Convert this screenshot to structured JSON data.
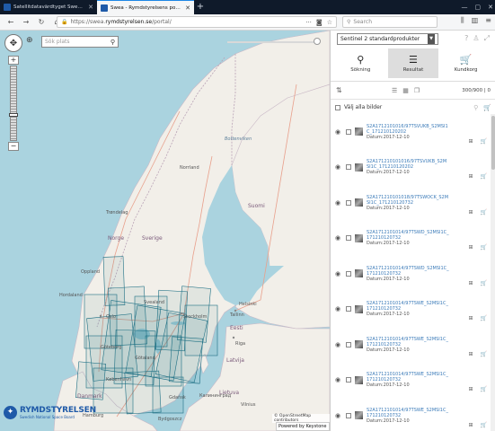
{
  "browser": {
    "tabs": [
      {
        "title": "Satellitdatavärdtyget Swea - Ry",
        "active": false,
        "favicon_color": "#1f5aa8"
      },
      {
        "title": "Swea - Rymdstyrelsens portal f",
        "active": true,
        "favicon_color": "#1f5aa8"
      }
    ],
    "new_tab": "+",
    "url_prefix": "https://swea.",
    "url_domain": "rymdstyrelsen.se",
    "url_path": "/portal/",
    "search_placeholder": "Search"
  },
  "map": {
    "search_placeholder": "Sök plats",
    "zoom_in": "+",
    "zoom_out": "−",
    "labels": {
      "norway": "Norge",
      "sweden": "Sverige",
      "finland": "Suomi",
      "estonia": "Eesti",
      "latvia": "Latvija",
      "lithuania": "Lietuva",
      "denmark": "Danmark",
      "norrland": "Norrland",
      "svealand": "Svealand",
      "gotaland": "Götaland",
      "oppland": "Oppland",
      "hordaland": "Hordaland",
      "trondelag": "Trøndelag",
      "oslo": "Oslo",
      "stockholm": "Stockholm",
      "helsinki": "Helsinki",
      "tallinn": "Tallinn",
      "riga": "Riga",
      "vilnius": "Vilnius",
      "kaliningrad": "Калининград",
      "gdansk": "Gdańsk",
      "bydgoszcz": "Bydgoszcz",
      "hamburg": "Hamburg",
      "kobenhavn": "København",
      "goteborg": "Göteborg",
      "bothnia": "Bottenviken"
    },
    "logo_name": "RYMDSTYRELSEN",
    "logo_sub": "Swedish National Space Board",
    "attribution": "© OpenStreetMap contributors",
    "powered_by": "Powered by Keystone"
  },
  "panel": {
    "product": "Sentinel 2 standardprodukter",
    "tabs": [
      {
        "label": "Sökning",
        "icon": "search-icon",
        "active": false
      },
      {
        "label": "Resultat",
        "icon": "list-icon",
        "active": true
      },
      {
        "label": "Kundkorg",
        "icon": "cart-icon",
        "active": false
      }
    ],
    "count": "300/900 | 0",
    "select_all": "Välj alla bilder",
    "results": [
      {
        "name": "S2A1712101016/97TSVUKB_S2MSI1C_171210120202",
        "date": "Datum:2017-12-10"
      },
      {
        "name": "S2A171210101016/97TSVUKB_S2MSI1C_171210120202",
        "date": "Datum:2017-12-10"
      },
      {
        "name": "S2A171210101018/97TSWOCK_S2MSI1C_171210120732",
        "date": "Datum:2017-12-10"
      },
      {
        "name": "S2A1712101014/97TSWD_S2MSI1C_171210120732",
        "date": "Datum:2017-12-10"
      },
      {
        "name": "S2A1712101014/97TSWD_S2MSI1C_171210120732",
        "date": "Datum:2017-12-10"
      },
      {
        "name": "S2A1712101014/97TSWE_S2MSI1C_171210120732",
        "date": "Datum:2017-12-10"
      },
      {
        "name": "S2A1712101014/97TSWE_S2MSI1C_171210120732",
        "date": "Datum:2017-12-10"
      },
      {
        "name": "S2A1712101014/97TSWE_S2MSI1C_171210120732",
        "date": "Datum:2017-12-10"
      },
      {
        "name": "S2A1712101014/97TSWE_S2MSI1C_171210120732",
        "date": "Datum:2017-12-10"
      }
    ]
  },
  "colors": {
    "sea": "#aad3df",
    "land": "#f2efe9",
    "footprint": "#1d6f84",
    "link": "#3a7ab8",
    "brand": "#1f5aa8"
  }
}
